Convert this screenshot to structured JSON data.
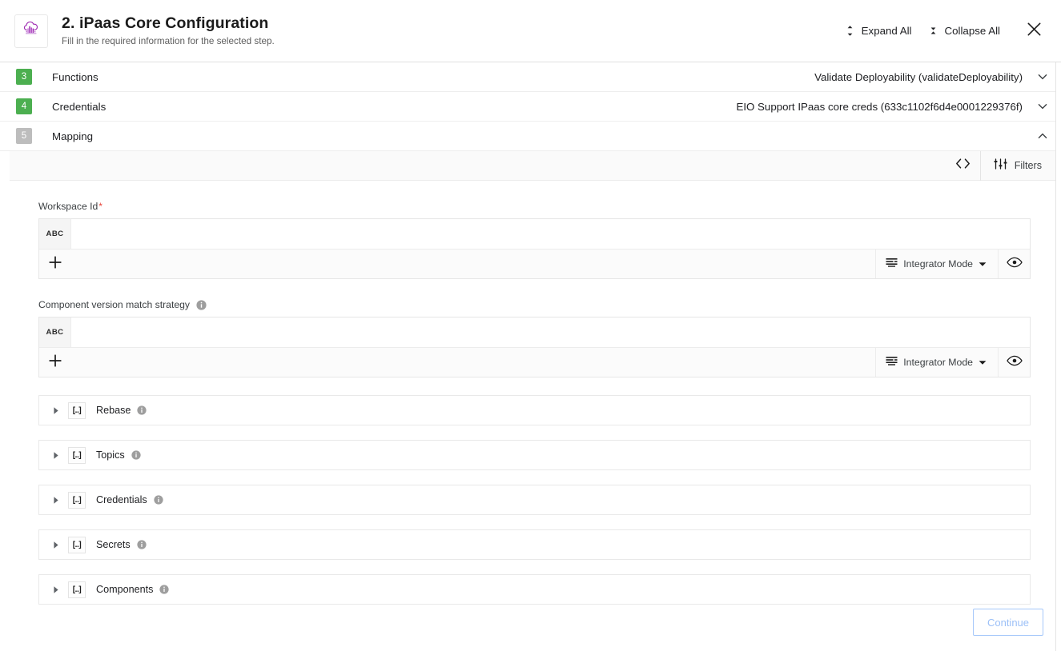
{
  "header": {
    "logo_icon": "cloud-city-icon",
    "title": "2. iPaas Core Configuration",
    "subtitle": "Fill in the required information for the selected step.",
    "expand_all_label": "Expand All",
    "expand_all_icon": "unfold-more-icon",
    "collapse_all_label": "Collapse All",
    "collapse_all_icon": "unfold-less-icon",
    "close_icon": "close-icon"
  },
  "steps": [
    {
      "number": "3",
      "label": "Functions",
      "value": "Validate Deployability (validateDeployability)",
      "badge_color": "#4caf50",
      "expanded": false,
      "chevron_icon": "chevron-down-icon"
    },
    {
      "number": "4",
      "label": "Credentials",
      "value": "EIO Support IPaas core creds (633c1102f6d4e0001229376f)",
      "badge_color": "#4caf50",
      "expanded": false,
      "chevron_icon": "chevron-down-icon"
    },
    {
      "number": "5",
      "label": "Mapping",
      "value": "",
      "badge_color": "#bdbdbd",
      "expanded": true,
      "chevron_icon": "chevron-up-icon"
    }
  ],
  "mapping_toolbar": {
    "code_icon": "code-brackets-icon",
    "filters_icon": "tune-sliders-icon",
    "filters_label": "Filters"
  },
  "fields": [
    {
      "label": "Workspace Id",
      "required": true,
      "has_info": false,
      "type_badge": "ABC",
      "value": "",
      "add_icon": "plus-icon",
      "mode_icon": "list-lines-icon",
      "mode_label": "Integrator Mode",
      "mode_caret_icon": "caret-down-icon",
      "preview_icon": "eye-icon"
    },
    {
      "label": "Component version match strategy",
      "required": false,
      "has_info": true,
      "type_badge": "ABC",
      "value": "",
      "add_icon": "plus-icon",
      "mode_icon": "list-lines-icon",
      "mode_label": "Integrator Mode",
      "mode_caret_icon": "caret-down-icon",
      "preview_icon": "eye-icon"
    }
  ],
  "array_rows": [
    {
      "label": "Rebase",
      "type_badge": "[..]",
      "caret_icon": "caret-right-icon",
      "info_icon": "info-icon"
    },
    {
      "label": "Topics",
      "type_badge": "[..]",
      "caret_icon": "caret-right-icon",
      "info_icon": "info-icon"
    },
    {
      "label": "Credentials",
      "type_badge": "[..]",
      "caret_icon": "caret-right-icon",
      "info_icon": "info-icon"
    },
    {
      "label": "Secrets",
      "type_badge": "[..]",
      "caret_icon": "caret-right-icon",
      "info_icon": "info-icon"
    },
    {
      "label": "Components",
      "type_badge": "[..]",
      "caret_icon": "caret-right-icon",
      "info_icon": "info-icon"
    }
  ],
  "footer": {
    "continue_label": "Continue",
    "continue_disabled": true
  },
  "colors": {
    "badge_done": "#4caf50",
    "badge_pending": "#bdbdbd",
    "required_star": "#e8443a",
    "accent_logo": "#9c27b0",
    "continue_border": "#a6c8fa",
    "continue_text": "#9cc0f7"
  }
}
